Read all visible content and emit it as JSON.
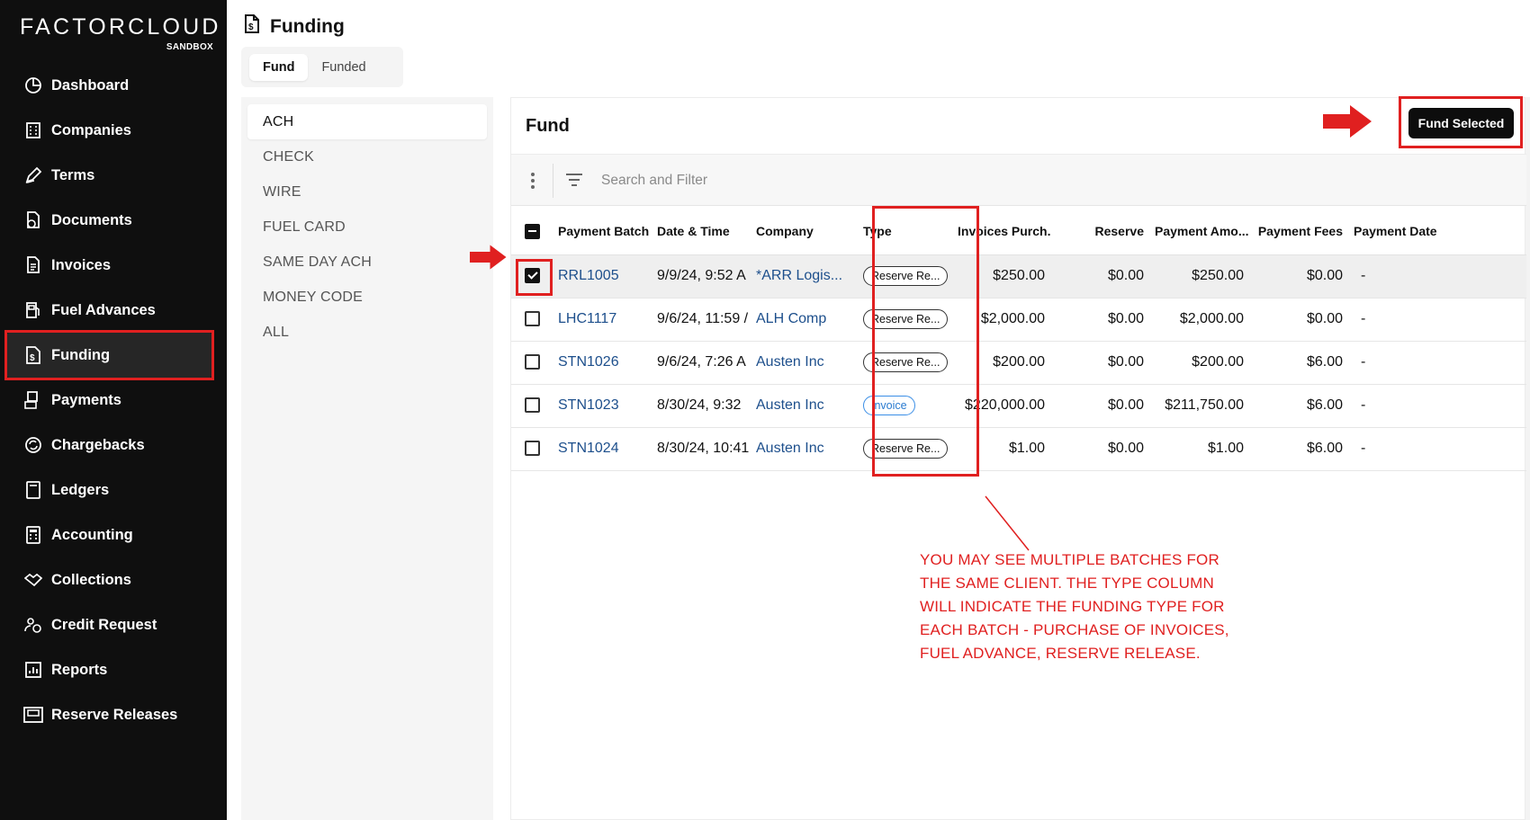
{
  "brand": {
    "name": "FACTORCLOUD",
    "env": "SANDBOX"
  },
  "sidebar": {
    "items": [
      {
        "label": "Dashboard",
        "icon": "dashboard-icon"
      },
      {
        "label": "Companies",
        "icon": "building-icon"
      },
      {
        "label": "Terms",
        "icon": "pen-icon"
      },
      {
        "label": "Documents",
        "icon": "documents-icon"
      },
      {
        "label": "Invoices",
        "icon": "invoice-icon"
      },
      {
        "label": "Fuel Advances",
        "icon": "fuel-icon"
      },
      {
        "label": "Funding",
        "icon": "funding-icon",
        "active": true
      },
      {
        "label": "Payments",
        "icon": "payments-icon"
      },
      {
        "label": "Chargebacks",
        "icon": "chargeback-icon"
      },
      {
        "label": "Ledgers",
        "icon": "ledger-icon"
      },
      {
        "label": "Accounting",
        "icon": "calculator-icon"
      },
      {
        "label": "Collections",
        "icon": "handshake-icon"
      },
      {
        "label": "Credit Request",
        "icon": "credit-request-icon"
      },
      {
        "label": "Reports",
        "icon": "reports-icon"
      },
      {
        "label": "Reserve Releases",
        "icon": "reserve-icon"
      }
    ]
  },
  "header": {
    "title": "Funding",
    "icon": "funding-icon"
  },
  "tabs": [
    {
      "label": "Fund",
      "active": true
    },
    {
      "label": "Funded"
    }
  ],
  "methods": [
    {
      "label": "ACH",
      "active": true
    },
    {
      "label": "CHECK"
    },
    {
      "label": "WIRE"
    },
    {
      "label": "FUEL CARD"
    },
    {
      "label": "SAME DAY ACH"
    },
    {
      "label": "MONEY CODE"
    },
    {
      "label": "ALL"
    }
  ],
  "card": {
    "title": "Fund",
    "fund_button": "Fund Selected",
    "search_placeholder": "Search and Filter"
  },
  "table": {
    "columns": [
      "Payment Batch",
      "Date & Time",
      "Company",
      "Type",
      "Invoices Purch...",
      "Reserve",
      "Payment Amo...",
      "Payment Fees",
      "Payment Date"
    ],
    "rows": [
      {
        "checked": true,
        "batch": "RRL1005",
        "datetime": "9/9/24, 9:52 A",
        "company": "*ARR Logis...",
        "type": "Reserve Re...",
        "type_style": "default",
        "invoices": "$250.00",
        "reserve": "$0.00",
        "amount": "$250.00",
        "fees": "$0.00",
        "date": "-"
      },
      {
        "checked": false,
        "batch": "LHC1117",
        "datetime": "9/6/24, 11:59 /",
        "company": "ALH Comp",
        "type": "Reserve Re...",
        "type_style": "default",
        "invoices": "$2,000.00",
        "reserve": "$0.00",
        "amount": "$2,000.00",
        "fees": "$0.00",
        "date": "-"
      },
      {
        "checked": false,
        "batch": "STN1026",
        "datetime": "9/6/24, 7:26 A",
        "company": "Austen Inc",
        "type": "Reserve Re...",
        "type_style": "default",
        "invoices": "$200.00",
        "reserve": "$0.00",
        "amount": "$200.00",
        "fees": "$6.00",
        "date": "-"
      },
      {
        "checked": false,
        "batch": "STN1023",
        "datetime": "8/30/24, 9:32",
        "company": "Austen Inc",
        "type": "Invoice",
        "type_style": "blue",
        "invoices": "$220,000.00",
        "reserve": "$0.00",
        "amount": "$211,750.00",
        "fees": "$6.00",
        "date": "-"
      },
      {
        "checked": false,
        "batch": "STN1024",
        "datetime": "8/30/24, 10:41",
        "company": "Austen Inc",
        "type": "Reserve Re...",
        "type_style": "default",
        "invoices": "$1.00",
        "reserve": "$0.00",
        "amount": "$1.00",
        "fees": "$6.00",
        "date": "-"
      }
    ]
  },
  "annotation": {
    "lines": [
      "YOU MAY SEE MULTIPLE BATCHES FOR",
      "THE SAME CLIENT. THE TYPE COLUMN",
      "WILL INDICATE THE FUNDING TYPE FOR",
      "EACH BATCH - PURCHASE OF INVOICES,",
      "FUEL ADVANCE, RESERVE RELEASE."
    ]
  },
  "colors": {
    "highlight": "#e02020",
    "sidebar_bg": "#0f0f0f",
    "link": "#1d4f8c",
    "invoice_badge": "#2a7bd0"
  }
}
